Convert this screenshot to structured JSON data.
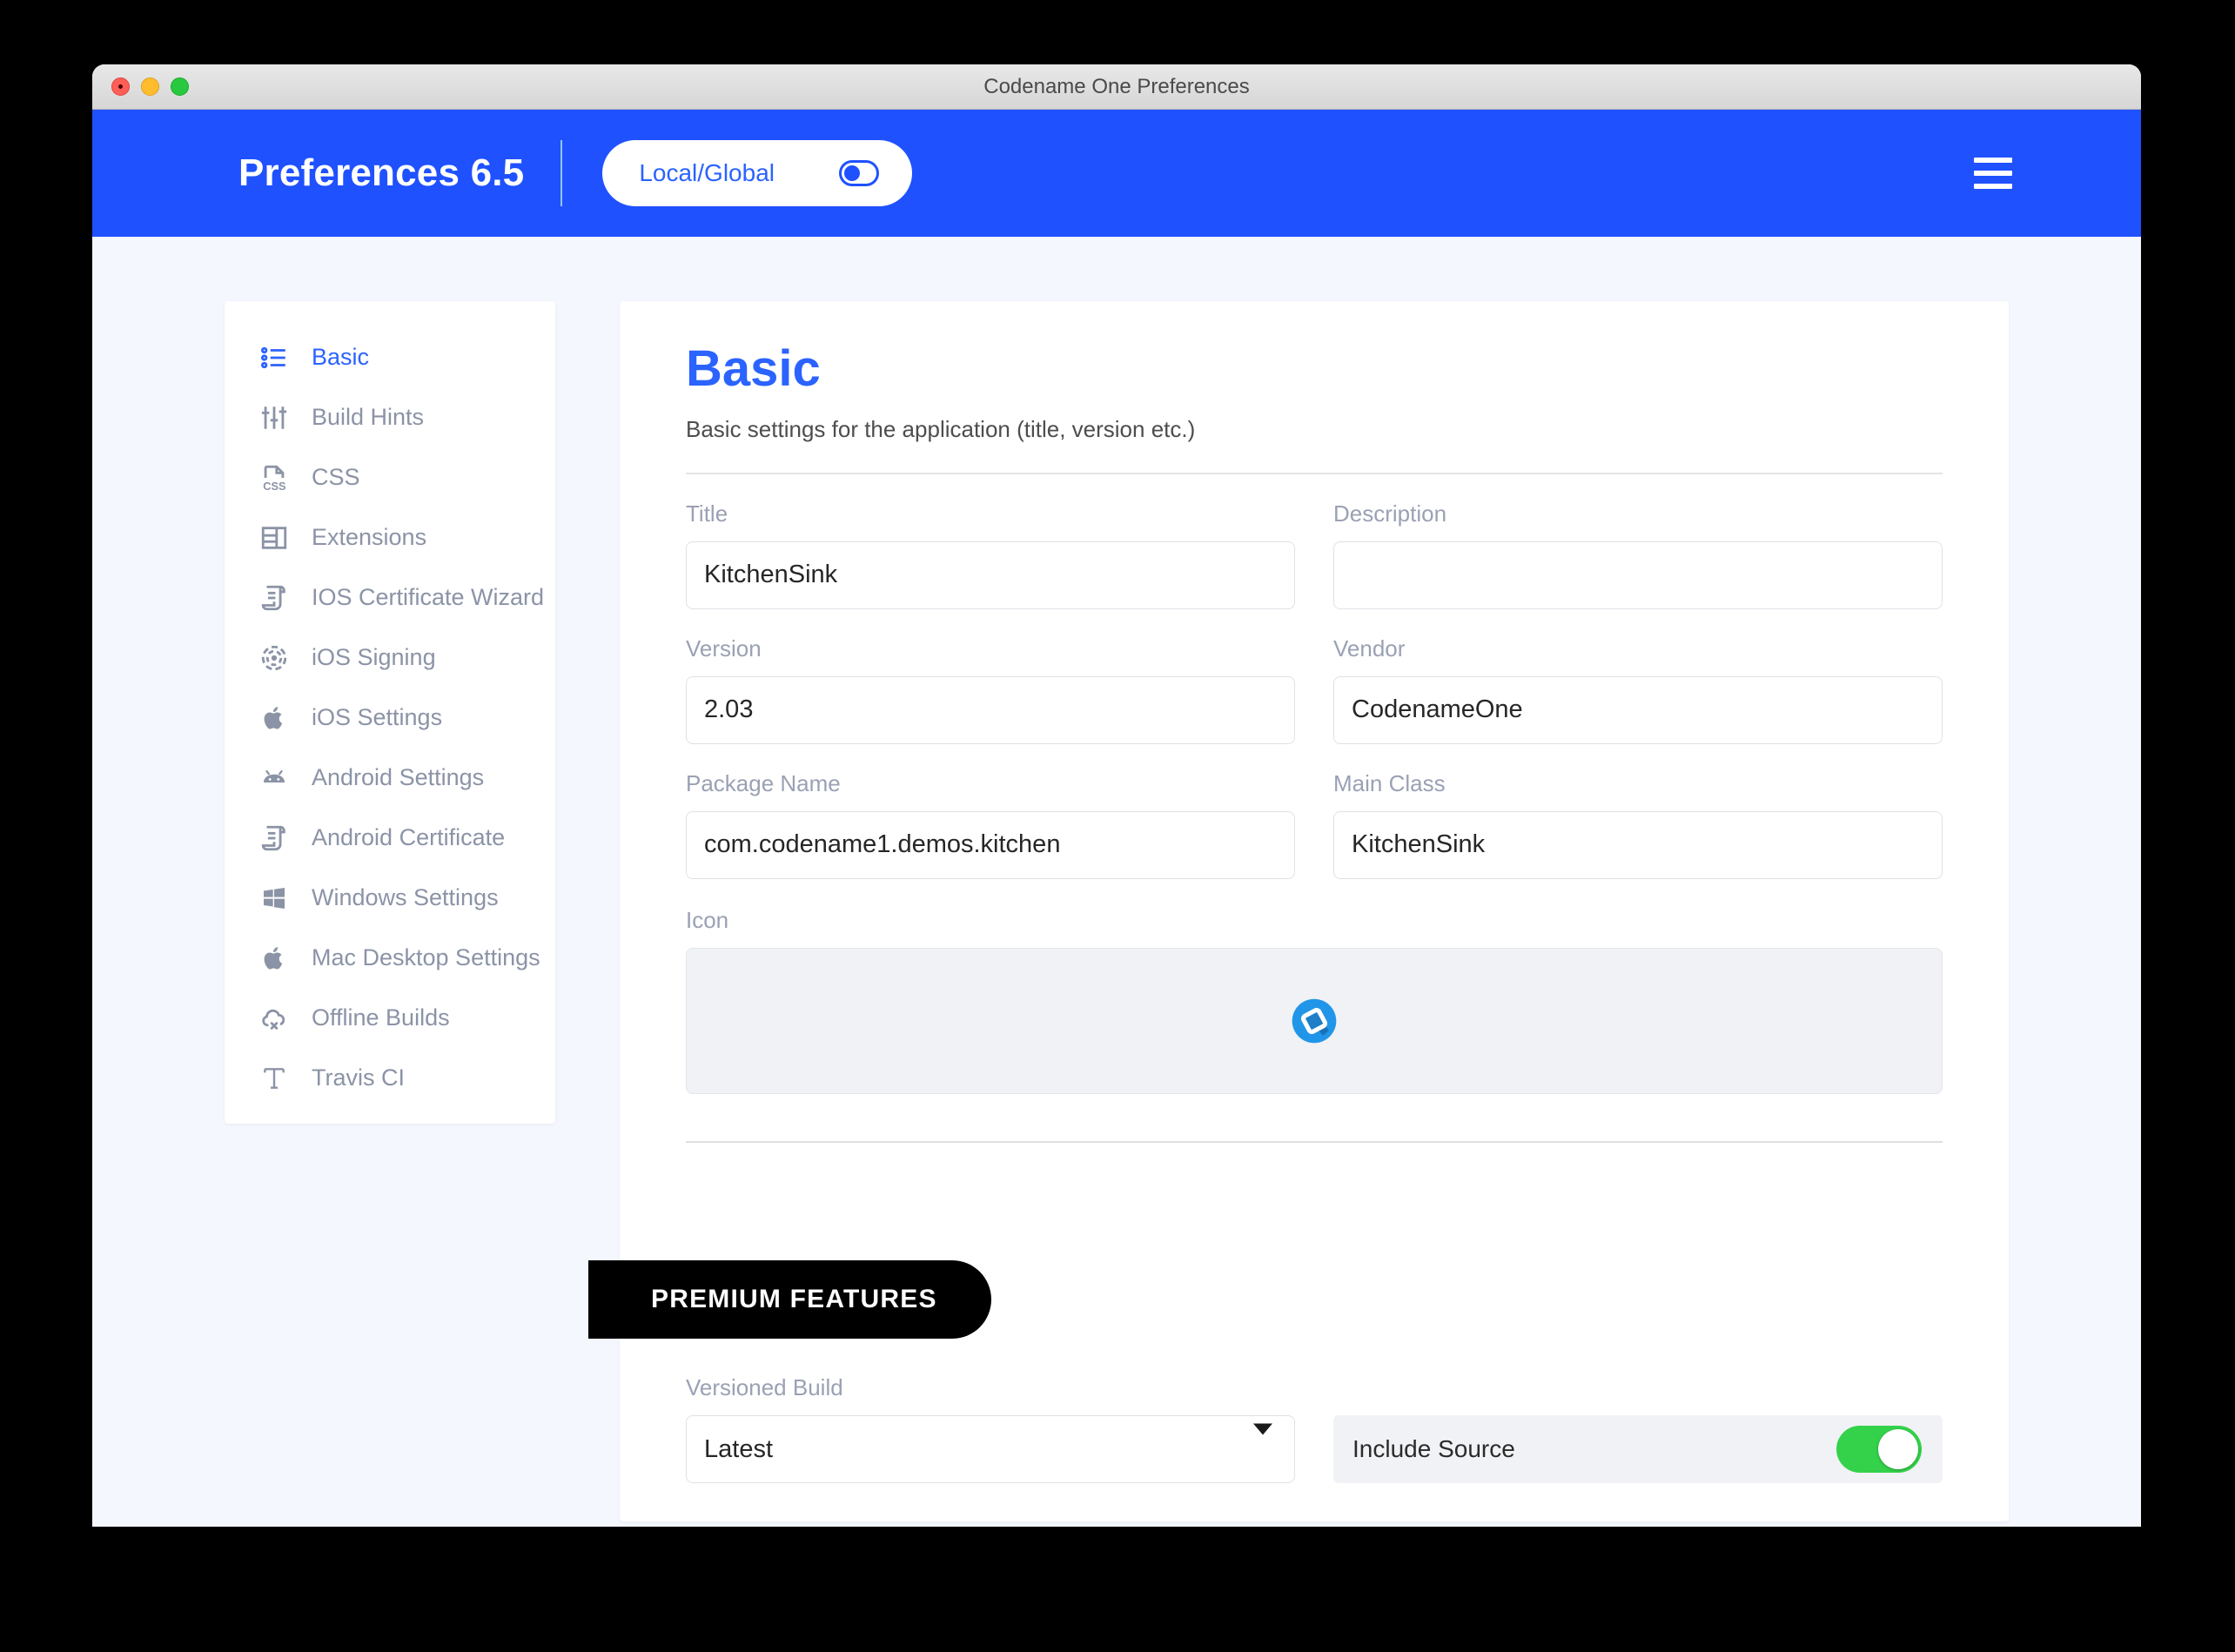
{
  "window": {
    "title": "Codename One Preferences",
    "traffic_lights": [
      "close-button",
      "minimize-button",
      "maximize-button"
    ]
  },
  "appbar": {
    "title": "Preferences 6.5",
    "scope_label": "Local/Global",
    "scope_state": "off",
    "menu_icon": "hamburger-menu-icon",
    "background": "#1f51ff"
  },
  "sidebar": {
    "items": [
      {
        "label": "Basic",
        "icon": "list-settings-icon",
        "active": true
      },
      {
        "label": "Build Hints",
        "icon": "sliders-icon",
        "active": false
      },
      {
        "label": "CSS",
        "icon": "css-file-icon",
        "active": false
      },
      {
        "label": "Extensions",
        "icon": "extensions-icon",
        "active": false
      },
      {
        "label": "IOS Certificate Wizard",
        "icon": "certificate-scroll-icon",
        "active": false
      },
      {
        "label": "iOS Signing",
        "icon": "fingerprint-icon",
        "active": false
      },
      {
        "label": "iOS Settings",
        "icon": "apple-icon",
        "active": false
      },
      {
        "label": "Android Settings",
        "icon": "android-icon",
        "active": false
      },
      {
        "label": "Android Certificate",
        "icon": "certificate-scroll-icon",
        "active": false
      },
      {
        "label": "Windows Settings",
        "icon": "windows-icon",
        "active": false
      },
      {
        "label": "Mac Desktop Settings",
        "icon": "apple-icon",
        "active": false
      },
      {
        "label": "Offline Builds",
        "icon": "cloud-off-icon",
        "active": false
      },
      {
        "label": "Travis CI",
        "icon": "travis-ci-icon",
        "active": false
      }
    ]
  },
  "main": {
    "title": "Basic",
    "subtitle": "Basic settings for the application (title, version etc.)",
    "fields": {
      "title": {
        "label": "Title",
        "value": "KitchenSink",
        "placeholder": ""
      },
      "description": {
        "label": "Description",
        "value": "",
        "placeholder": ""
      },
      "version": {
        "label": "Version",
        "value": "2.03",
        "placeholder": ""
      },
      "vendor": {
        "label": "Vendor",
        "value": "CodenameOne",
        "placeholder": ""
      },
      "package_name": {
        "label": "Package Name",
        "value": "com.codename1.demos.kitchen",
        "placeholder": ""
      },
      "main_class": {
        "label": "Main Class",
        "value": "KitchenSink",
        "placeholder": ""
      },
      "icon": {
        "label": "Icon",
        "icon_name": "codename-one-logo-icon"
      }
    },
    "premium": {
      "badge": "PREMIUM FEATURES",
      "versioned_build": {
        "label": "Versioned Build",
        "value": "Latest",
        "options": [
          "Latest"
        ]
      },
      "include_source": {
        "label": "Include Source",
        "state": "on"
      }
    }
  },
  "colors": {
    "accent": "#1f51ff",
    "accent_text": "#2b63ff",
    "page_bg": "#f4f7fe",
    "card_bg": "#ffffff",
    "muted_text": "#9aa1b4",
    "toggle_on": "#34d24a",
    "badge_bg": "#000000"
  }
}
